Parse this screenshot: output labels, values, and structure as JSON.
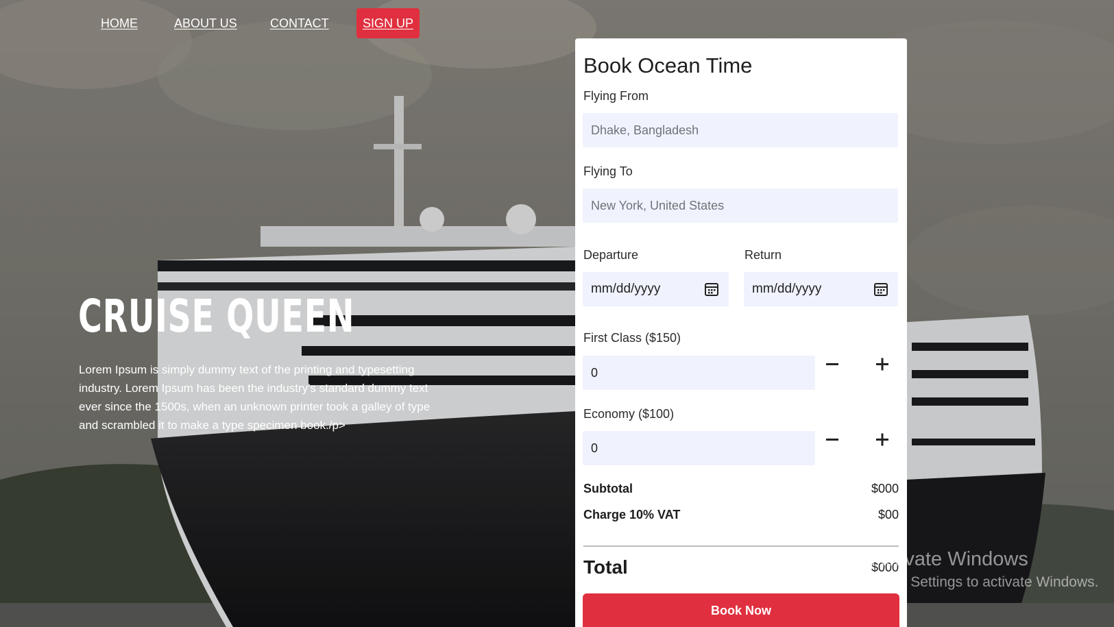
{
  "nav": {
    "home": "HOME",
    "about": "ABOUT US",
    "contact": "CONTACT",
    "signup": "SIGN UP"
  },
  "hero": {
    "title": "CRUISE QUEEN",
    "text": "Lorem Ipsum is simply dummy text of the printing and typesetting industry. Lorem Ipsum has been the industry's standard dummy text ever since the 1500s, when an unknown printer took a galley of type and scrambled it to make a type specimen book./p>"
  },
  "booking": {
    "title": "Book Ocean Time",
    "flying_from_label": "Flying From",
    "flying_from_placeholder": "Dhake, Bangladesh",
    "flying_to_label": "Flying To",
    "flying_to_placeholder": "New York, United States",
    "departure_label": "Departure",
    "departure_value": "mm/dd/yyyy",
    "return_label": "Return",
    "return_value": "mm/dd/yyyy",
    "first_class_label": "First Class ($150)",
    "first_class_value": "0",
    "economy_label": "Economy ($100)",
    "economy_value": "0",
    "subtotal_label": "Subtotal",
    "subtotal_value": "$000",
    "vat_label": "Charge 10% VAT",
    "vat_value": "$00",
    "total_label": "Total",
    "total_value": "$000",
    "book_button": "Book Now"
  },
  "icons": {
    "calendar": "calendar-icon",
    "minus": "minus-icon",
    "plus": "plus-icon"
  },
  "colors": {
    "accent": "#e0303f",
    "field_bg": "#f0f3fd"
  },
  "watermark": {
    "line1": "Activate Windows",
    "line2": "Go to Settings to activate Windows."
  }
}
